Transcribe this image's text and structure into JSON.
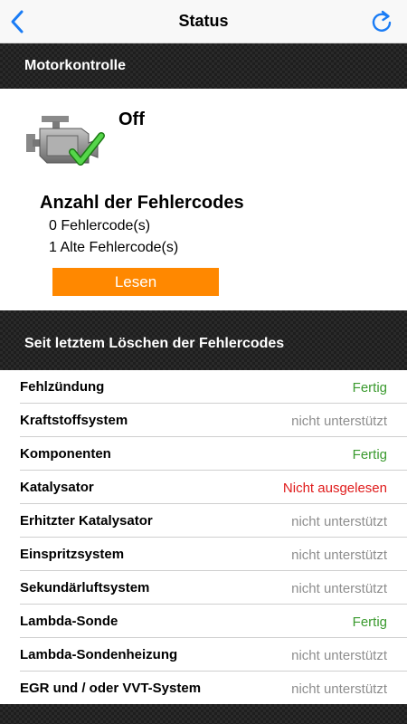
{
  "navbar": {
    "title": "Status",
    "back_icon": "chevron-left-icon",
    "refresh_icon": "refresh-icon",
    "accent_color": "#1a7cf5"
  },
  "engine_check": {
    "header": "Motorkontrolle",
    "icon": "check-engine-ok-icon",
    "mil_status": "Off",
    "codes_title": "Anzahl der Fehlercodes",
    "current_codes": "0 Fehlercode(s)",
    "old_codes": "1 Alte Fehlercode(s)",
    "read_button": "Lesen",
    "button_color": "#ff8800"
  },
  "monitors": {
    "header": "Seit letztem Löschen der Fehlercodes",
    "status_colors": {
      "ready": "#3a9a2e",
      "not_supported": "#8e8e8e",
      "not_read": "#e01b1b"
    },
    "items": [
      {
        "name": "Fehlzündung",
        "status": "Fertig",
        "state": "ready"
      },
      {
        "name": "Kraftstoffsystem",
        "status": "nicht unterstützt",
        "state": "not_supported"
      },
      {
        "name": "Komponenten",
        "status": "Fertig",
        "state": "ready"
      },
      {
        "name": "Katalysator",
        "status": "Nicht ausgelesen",
        "state": "not_read"
      },
      {
        "name": "Erhitzter Katalysator",
        "status": "nicht unterstützt",
        "state": "not_supported"
      },
      {
        "name": "Einspritzsystem",
        "status": "nicht unterstützt",
        "state": "not_supported"
      },
      {
        "name": "Sekundärluftsystem",
        "status": "nicht unterstützt",
        "state": "not_supported"
      },
      {
        "name": "Lambda-Sonde",
        "status": "Fertig",
        "state": "ready"
      },
      {
        "name": "Lambda-Sondenheizung",
        "status": "nicht unterstützt",
        "state": "not_supported"
      },
      {
        "name": "EGR und / oder VVT-System",
        "status": "nicht unterstützt",
        "state": "not_supported"
      }
    ]
  }
}
